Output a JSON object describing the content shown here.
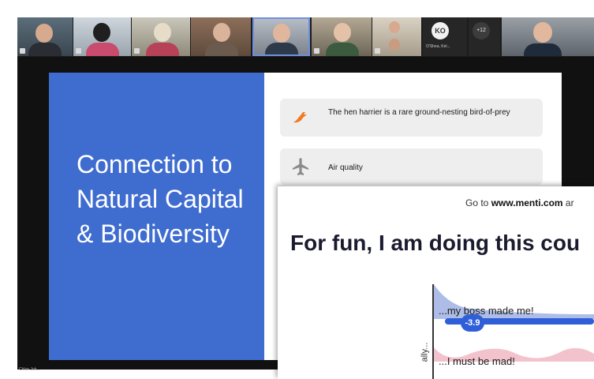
{
  "participants": {
    "avatar_initials": "KO",
    "avatar_name": "O'Shea, Kel...",
    "more_count": "+12"
  },
  "slide": {
    "title": "Connection to Natural Capital & Biodiversity",
    "cards": [
      {
        "icon": "bird-icon",
        "text": "The hen harrier is a rare ground-nesting bird-of-prey"
      },
      {
        "icon": "airplane-icon",
        "text": "Air quality"
      }
    ],
    "colors": {
      "panel": "#3f6ccf",
      "bird_icon": "#f07a22",
      "airplane_icon": "#8a8a8a"
    }
  },
  "menti": {
    "goto_prefix": "Go to ",
    "goto_site": "www.menti.com",
    "goto_suffix": " ar",
    "question": "For fun, I am doing this cou",
    "y_label": "ally...",
    "options": [
      {
        "label": "...my boss made me!",
        "score": "-3.9"
      },
      {
        "label": "...I must be mad!"
      }
    ],
    "colors": {
      "accent": "#2f5fd8",
      "dist_blue": "#aebde7",
      "dist_pink": "#f2c3cc"
    }
  },
  "footer": {
    "caption": "Chloe Joh..."
  }
}
